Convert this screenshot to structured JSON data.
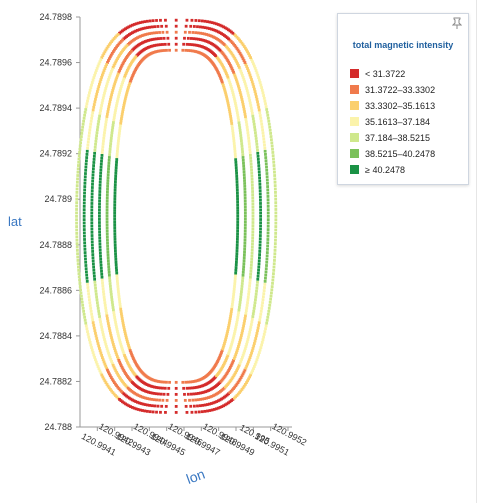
{
  "chart_data": {
    "type": "scatter",
    "xlabel": "lon",
    "ylabel": "lat",
    "xlim": [
      120.994,
      120.9952
    ],
    "ylim": [
      24.788,
      24.7898
    ],
    "x_ticks": [
      "120.9941",
      "120.9942",
      "120.9943",
      "120.9944",
      "120.9945",
      "120.9946",
      "120.9947",
      "120.9948",
      "120.9949",
      "120.995",
      "120.9951",
      "120.9952"
    ],
    "y_ticks": [
      "24.7898",
      "24.7896",
      "24.7894",
      "24.7892",
      "24.789",
      "24.7888",
      "24.7886",
      "24.7884",
      "24.7882",
      "24.788"
    ],
    "legend": {
      "title": "total magnetic intensity",
      "placement": "top-right",
      "items": [
        {
          "label": "< 31.3722",
          "color": "#d42b2b"
        },
        {
          "label": "31.3722–33.3302",
          "color": "#f07a4c"
        },
        {
          "label": "33.3302–35.1613",
          "color": "#fbcf6d"
        },
        {
          "label": "35.1613–37.184",
          "color": "#fbf3ab"
        },
        {
          "label": "37.184–38.5215",
          "color": "#cfe88c"
        },
        {
          "label": "38.5215–40.2478",
          "color": "#7ac15a"
        },
        {
          "label": "≥ 40.2478",
          "color": "#1a9245"
        }
      ]
    },
    "track": {
      "shape": "closed loop (racetrack)",
      "lon_range": [
        120.99409,
        120.99502
      ],
      "lat_range": [
        24.78813,
        24.78972
      ]
    }
  }
}
